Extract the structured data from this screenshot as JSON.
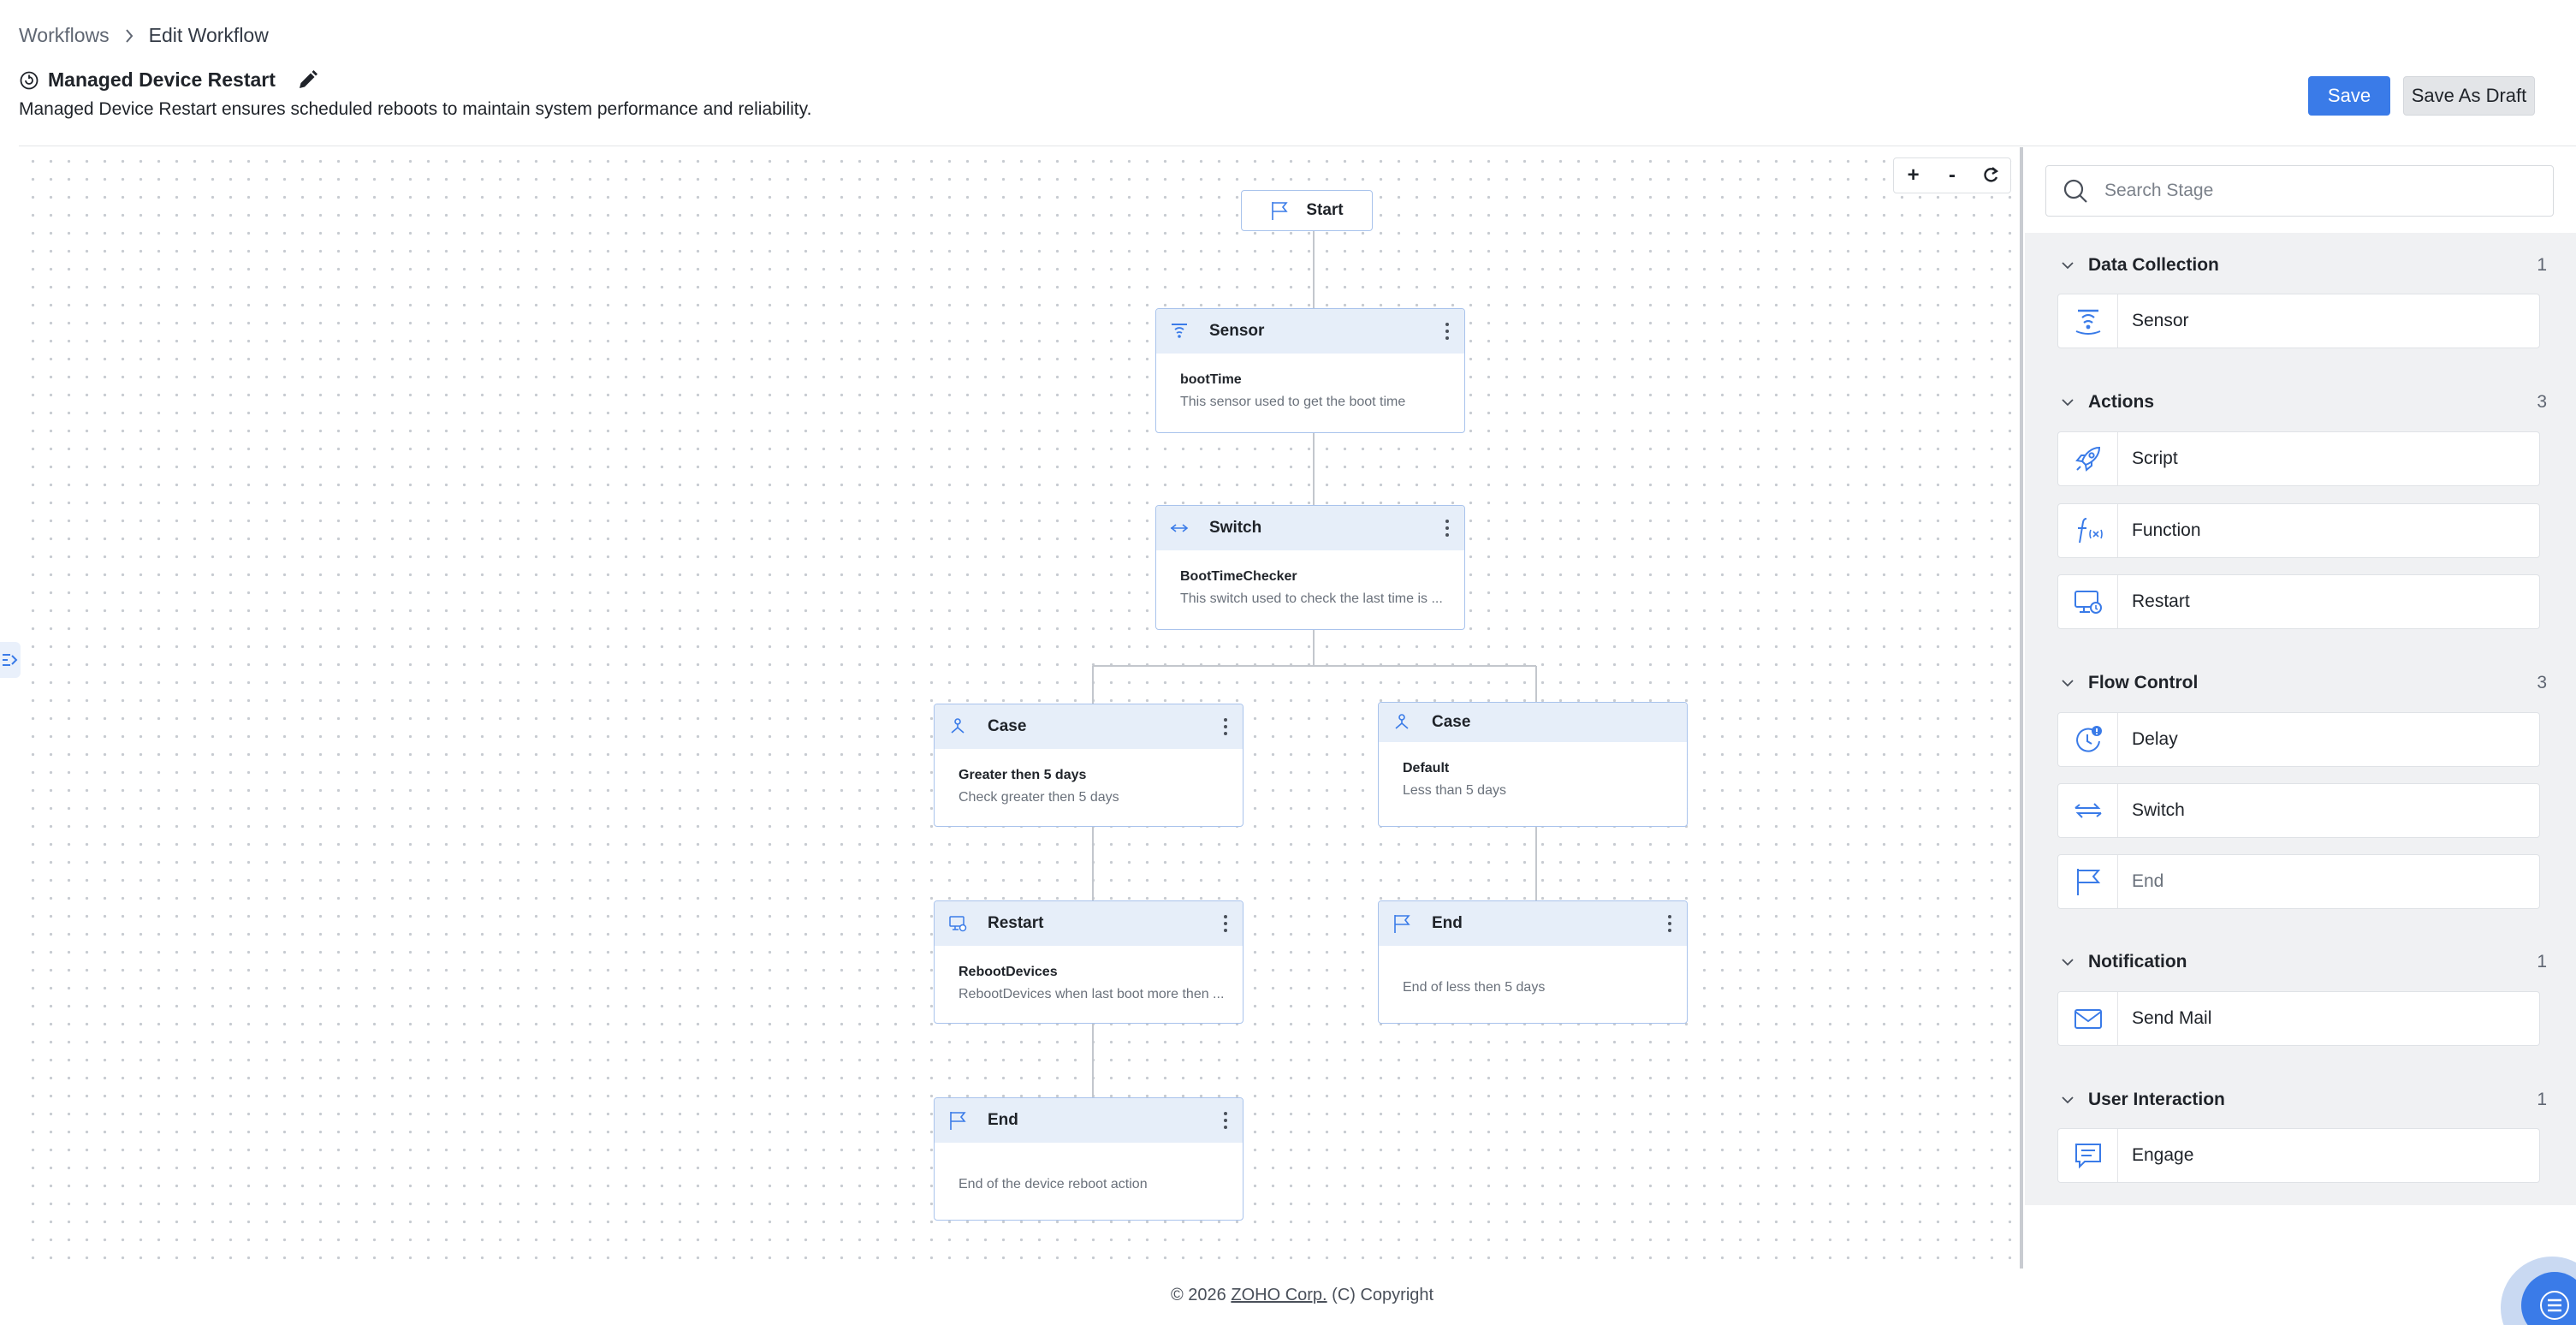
{
  "breadcrumb": {
    "root": "Workflows",
    "current": "Edit Workflow"
  },
  "workflow": {
    "title": "Managed Device Restart",
    "description": "Managed Device Restart ensures scheduled reboots to maintain system performance and reliability."
  },
  "actions": {
    "save": "Save",
    "save_draft": "Save As Draft"
  },
  "zoom": {
    "in": "+",
    "out": "-"
  },
  "nodes": {
    "start": "Start",
    "sensor": {
      "title": "Sensor",
      "name": "bootTime",
      "desc": "This sensor used to get the boot time"
    },
    "switch": {
      "title": "Switch",
      "name": "BootTimeChecker",
      "desc": "This switch used to check the last time is ..."
    },
    "case1": {
      "title": "Case",
      "name": "Greater then 5 days",
      "desc": "Check greater then 5 days"
    },
    "case2": {
      "title": "Case",
      "name": "Default",
      "desc": "Less than 5 days"
    },
    "restart": {
      "title": "Restart",
      "name": "RebootDevices",
      "desc": "RebootDevices when last boot more then ..."
    },
    "end1": {
      "title": "End",
      "desc": "End of less then 5 days"
    },
    "end2": {
      "title": "End",
      "desc": "End of the device reboot action"
    }
  },
  "sidebar": {
    "search_placeholder": "Search Stage",
    "sections": [
      {
        "title": "Data Collection",
        "count": "1",
        "items": [
          {
            "label": "Sensor",
            "icon": "sensor-icon"
          }
        ]
      },
      {
        "title": "Actions",
        "count": "3",
        "items": [
          {
            "label": "Script",
            "icon": "rocket-icon"
          },
          {
            "label": "Function",
            "icon": "function-icon"
          },
          {
            "label": "Restart",
            "icon": "monitor-restart-icon"
          }
        ]
      },
      {
        "title": "Flow Control",
        "count": "3",
        "items": [
          {
            "label": "Delay",
            "icon": "clock-icon"
          },
          {
            "label": "Switch",
            "icon": "switch-arrows-icon"
          },
          {
            "label": "End",
            "icon": "flag-icon"
          }
        ]
      },
      {
        "title": "Notification",
        "count": "1",
        "items": [
          {
            "label": "Send Mail",
            "icon": "mail-icon"
          }
        ]
      },
      {
        "title": "User Interaction",
        "count": "1",
        "items": [
          {
            "label": "Engage",
            "icon": "chat-icon"
          }
        ]
      }
    ]
  },
  "footer": {
    "prefix": "© 2026",
    "company": "ZOHO Corp.",
    "suffix": "(C) Copyright"
  },
  "colors": {
    "accent": "#3a7be8",
    "node_border": "#a9c3ec",
    "node_header": "#e6eef9",
    "icon_blue": "#3a7be8"
  }
}
